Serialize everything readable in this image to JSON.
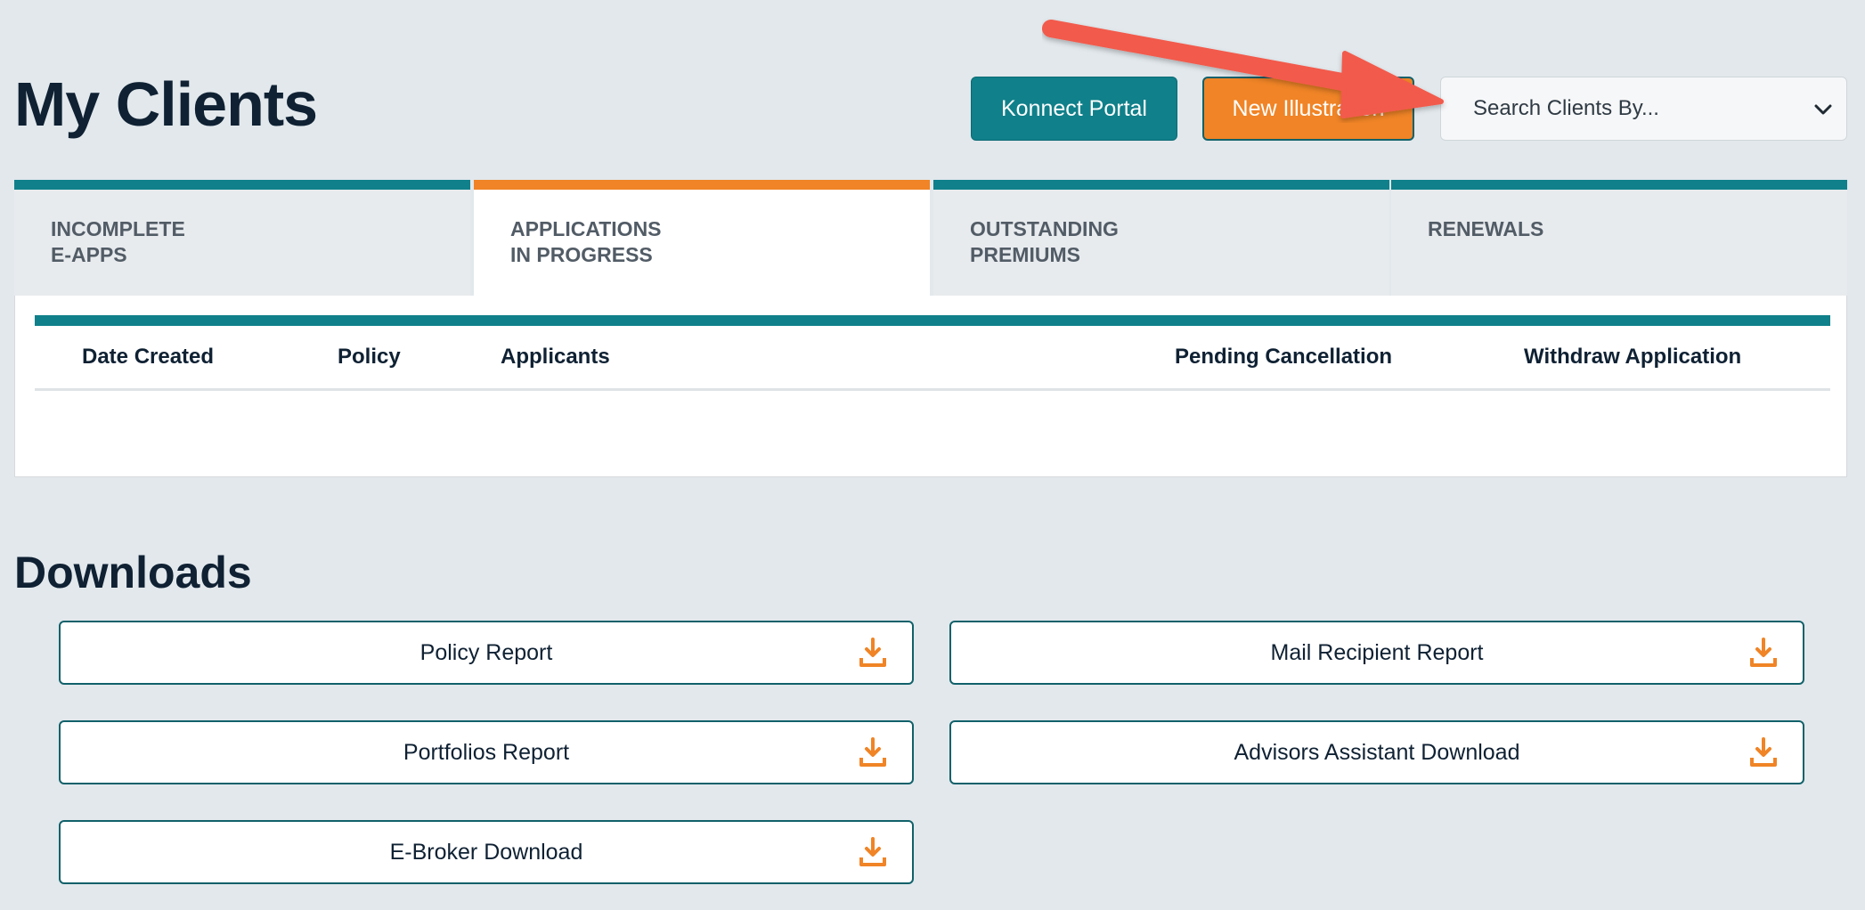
{
  "header": {
    "title": "My Clients",
    "konnect_label": "Konnect Portal",
    "new_illustration_label": "New Illustration",
    "search_placeholder": "Search Clients By..."
  },
  "tabs": [
    {
      "line1": "INCOMPLETE",
      "line2": "E-APPS",
      "active": false
    },
    {
      "line1": "APPLICATIONS",
      "line2": "IN PROGRESS",
      "active": true
    },
    {
      "line1": "OUTSTANDING",
      "line2": "PREMIUMS",
      "active": false
    },
    {
      "line1": "RENEWALS",
      "line2": "",
      "active": false
    }
  ],
  "table": {
    "columns": [
      "Date Created",
      "Policy",
      "Applicants",
      "Pending Cancellation",
      "Withdraw Application"
    ]
  },
  "downloads": {
    "title": "Downloads",
    "items": [
      {
        "label": "Policy Report",
        "icon": "download-icon"
      },
      {
        "label": "Mail Recipient Report",
        "icon": "download-icon"
      },
      {
        "label": "Portfolios Report",
        "icon": "download-icon"
      },
      {
        "label": "Advisors Assistant Download",
        "icon": "download-icon"
      },
      {
        "label": "E-Broker Download",
        "icon": "download-icon"
      }
    ]
  },
  "colors": {
    "teal": "#10808a",
    "orange": "#f08426",
    "annotation_arrow": "#f25a4c",
    "background": "#e2e8ec"
  }
}
